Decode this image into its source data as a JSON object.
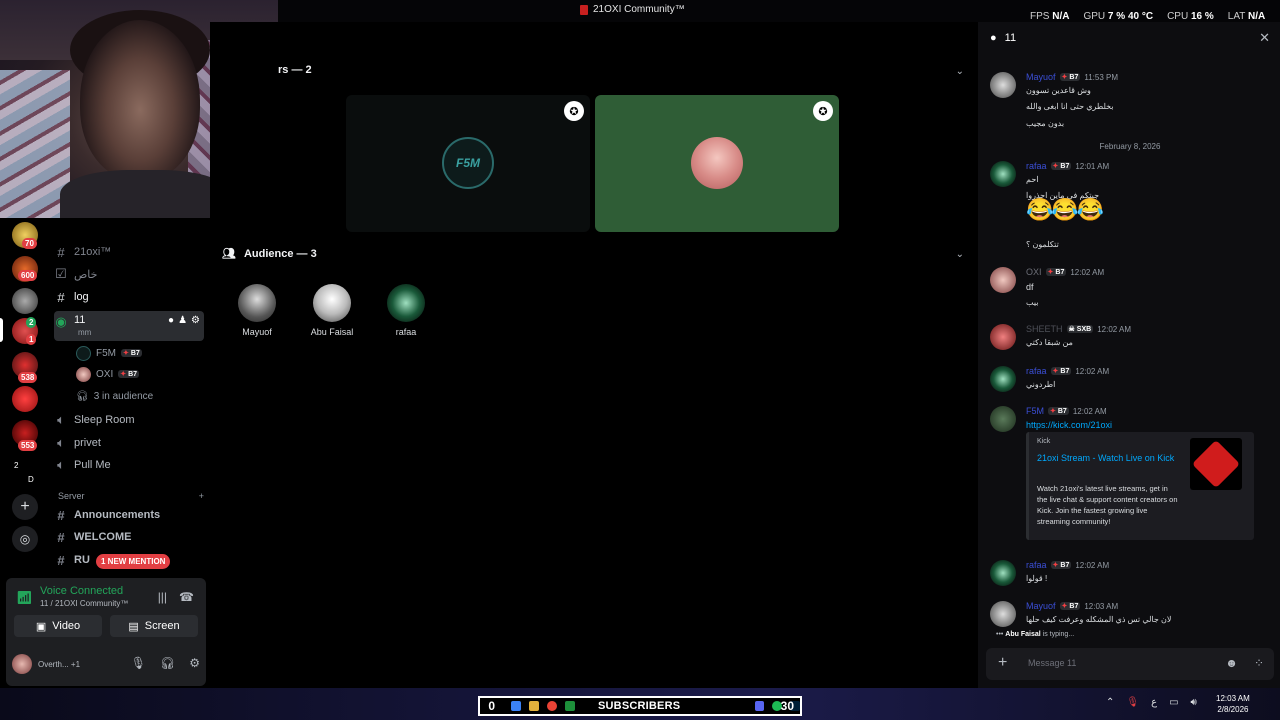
{
  "window": {
    "title": "21OXI Community™"
  },
  "perf": {
    "fps_label": "FPS",
    "fps": "N/A",
    "gpu_label": "GPU",
    "gpu": "7 %",
    "gpu_temp": "40 °C",
    "cpu_label": "CPU",
    "cpu": "16 %",
    "lat_label": "LAT",
    "lat": "N/A"
  },
  "rail": {
    "badges": [
      "70",
      "600",
      "2",
      "1",
      "538",
      "553"
    ],
    "misc": [
      "2",
      "D"
    ]
  },
  "channels": {
    "c1": "21oxi™",
    "c2": "خاص",
    "c3": "log",
    "active": {
      "name": "11",
      "topic": "mm"
    },
    "voice_users": [
      {
        "name": "F5M",
        "tag": "B7"
      },
      {
        "name": "OXI",
        "tag": "B7"
      }
    ],
    "audience": "3 in audience",
    "c5": "Sleep Room",
    "c6": "privet",
    "c7": "Pull Me",
    "category": "Server",
    "c8": "Announcements",
    "c9": "WELCOME",
    "c10": "RU"
  },
  "mention_pill": "1 NEW MENTION",
  "voice": {
    "status": "Voice Connected",
    "sub": "11 / 21OXI Community™",
    "video": "Video",
    "screen": "Screen",
    "user_status": "Overth...",
    "user_extra": "+1"
  },
  "stage": {
    "speakers_title": "rs — 2",
    "tile1_logo": "F5M",
    "audience_title": "Audience — 3",
    "audience": [
      "Mayuof",
      "Abu Faisal",
      "rafaa"
    ]
  },
  "chat": {
    "title": "11",
    "messages": [
      {
        "name": "Mayuof",
        "tag": "B7",
        "time": "11:53 PM",
        "lines": [
          "وش قاعدين تسوون",
          "بخلطري حتى انا ابغى والله",
          "بدون مجيب"
        ]
      },
      {
        "name": "rafaa",
        "tag": "B7",
        "time": "12:01 AM",
        "lines": [
          "احم",
          "جيتكم في ماين احذروا",
          "😂😂😂",
          "تتكلمون ؟"
        ]
      },
      {
        "name": "OXI",
        "tag": "B7",
        "time": "12:02 AM",
        "lines": [
          "df",
          "بيب"
        ]
      },
      {
        "name": "SHEETH",
        "tag": "SXB",
        "time": "12:02 AM",
        "lines": [
          "من شبقا دكتي"
        ]
      },
      {
        "name": "rafaa",
        "tag": "B7",
        "time": "12:02 AM",
        "lines": [
          "اطردوني"
        ]
      },
      {
        "name": "F5M",
        "tag": "B7",
        "time": "12:02 AM",
        "lines": [
          "https://kick.com/21oxi"
        ]
      },
      {
        "name": "rafaa",
        "tag": "B7",
        "time": "12:02 AM",
        "lines": [
          "قولوا !"
        ]
      },
      {
        "name": "Mayuof",
        "tag": "B7",
        "time": "12:03 AM",
        "lines": [
          "لان جالي تس ذي المشكله وعرفت كيف حلها"
        ]
      }
    ],
    "date_separator": "February 8, 2026",
    "embed": {
      "provider": "Kick",
      "title": "21oxi Stream - Watch Live on Kick",
      "description": "Watch 21oxi's latest live streams, get in the live chat & support content creators on Kick. Join the fastest growing live streaming community!"
    },
    "typing_user": "Abu Faisal",
    "typing_suffix": " is typing...",
    "composer_placeholder": "Message 11"
  },
  "taskbar": {
    "left_count": "0",
    "label": "SUBSCRIBERS",
    "right_count": "30",
    "clock_time": "12:03 AM",
    "clock_date": "2/8/2026",
    "lang": "ع"
  },
  "colors": {
    "accent_green": "#23a55a",
    "mention_red": "#e23f43",
    "link_blue": "#00a8fc",
    "kick_red": "#d01c1c",
    "tile_green": "#2f5d36"
  }
}
